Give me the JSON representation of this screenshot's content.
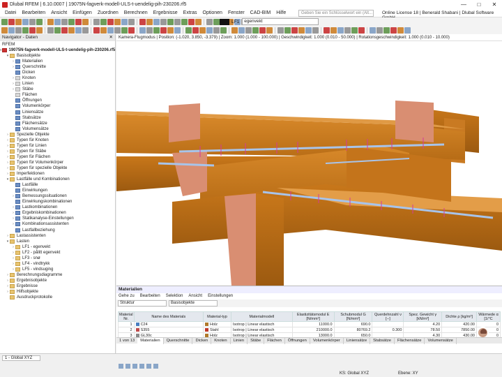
{
  "titlebar": {
    "title": "Dlubal RFEM | 6.10.0007 | 19075N-fagverk-modell-ULS-t-uendelig-pih-230206.rf5"
  },
  "menu": [
    "Datei",
    "Bearbeiten",
    "Ansicht",
    "Einfügen",
    "Zuordnen",
    "Berechnen",
    "Ergebnisse",
    "Extras",
    "Optionen",
    "Fenster",
    "CAD-BIM",
    "Hilfe"
  ],
  "search_placeholder": "Geben Sie ein Schlüsselwort ein (Alt...",
  "license": "Online License 18 | Benerald Shabani | Dlubal Software GmbH",
  "loadcase": {
    "code": "LF1",
    "name": "egenvekt"
  },
  "navigator": {
    "title": "Navigator - Daten",
    "root": "RFEM",
    "file": "19075N-fagverk-modell-ULS-t-uendelig-pih-230206.rf5",
    "items": [
      {
        "t": "Basisobjekte",
        "lvl": 1,
        "ex": "v",
        "ic": "f"
      },
      {
        "t": "Materialien",
        "lvl": 2,
        "ex": ">",
        "ic": "b"
      },
      {
        "t": "Querschnitte",
        "lvl": 2,
        "ex": ">",
        "ic": "b"
      },
      {
        "t": "Dicken",
        "lvl": 2,
        "ex": "",
        "ic": "b"
      },
      {
        "t": "Knoten",
        "lvl": 2,
        "ex": ">",
        "ic": "p"
      },
      {
        "t": "Linien",
        "lvl": 2,
        "ex": ">",
        "ic": "p"
      },
      {
        "t": "Stäbe",
        "lvl": 2,
        "ex": ">",
        "ic": "p"
      },
      {
        "t": "Flächen",
        "lvl": 2,
        "ex": "",
        "ic": "p"
      },
      {
        "t": "Öffnungen",
        "lvl": 2,
        "ex": "",
        "ic": "b"
      },
      {
        "t": "Volumenkörper",
        "lvl": 2,
        "ex": "",
        "ic": "b"
      },
      {
        "t": "Liniensätze",
        "lvl": 2,
        "ex": "",
        "ic": "b"
      },
      {
        "t": "Stabsätze",
        "lvl": 2,
        "ex": "",
        "ic": "b"
      },
      {
        "t": "Flächensätze",
        "lvl": 2,
        "ex": "",
        "ic": "b"
      },
      {
        "t": "Volumensätze",
        "lvl": 2,
        "ex": "",
        "ic": "b"
      },
      {
        "t": "Spezielle Objekte",
        "lvl": 1,
        "ex": ">",
        "ic": "f"
      },
      {
        "t": "Typen für Knoten",
        "lvl": 1,
        "ex": ">",
        "ic": "f"
      },
      {
        "t": "Typen für Linien",
        "lvl": 1,
        "ex": ">",
        "ic": "f"
      },
      {
        "t": "Typen für Stäbe",
        "lvl": 1,
        "ex": ">",
        "ic": "f"
      },
      {
        "t": "Typen für Flächen",
        "lvl": 1,
        "ex": ">",
        "ic": "f"
      },
      {
        "t": "Typen für Volumenkörper",
        "lvl": 1,
        "ex": ">",
        "ic": "f"
      },
      {
        "t": "Typen für spezielle Objekte",
        "lvl": 1,
        "ex": ">",
        "ic": "f"
      },
      {
        "t": "Imperfektionen",
        "lvl": 1,
        "ex": ">",
        "ic": "f"
      },
      {
        "t": "Lastfälle und Kombinationen",
        "lvl": 1,
        "ex": "v",
        "ic": "f"
      },
      {
        "t": "Lastfälle",
        "lvl": 2,
        "ex": "",
        "ic": "b"
      },
      {
        "t": "Einwirkungen",
        "lvl": 2,
        "ex": "",
        "ic": "b"
      },
      {
        "t": "Bemessungssituationen",
        "lvl": 2,
        "ex": ">",
        "ic": "b"
      },
      {
        "t": "Einwirkungskombinationen",
        "lvl": 2,
        "ex": "",
        "ic": "b"
      },
      {
        "t": "Lastkombinationen",
        "lvl": 2,
        "ex": ">",
        "ic": "b"
      },
      {
        "t": "Ergebniskombinationen",
        "lvl": 2,
        "ex": ">",
        "ic": "b"
      },
      {
        "t": "Statikanalyse-Einstellungen",
        "lvl": 2,
        "ex": ">",
        "ic": "b"
      },
      {
        "t": "Kombinationsassistenten",
        "lvl": 2,
        "ex": ">",
        "ic": "b"
      },
      {
        "t": "Lastfallbeziehung",
        "lvl": 2,
        "ex": "",
        "ic": "b"
      },
      {
        "t": "Lastassistenten",
        "lvl": 1,
        "ex": ">",
        "ic": "f"
      },
      {
        "t": "Lasten",
        "lvl": 1,
        "ex": "v",
        "ic": "f"
      },
      {
        "t": "LF1 - egenvekt",
        "lvl": 2,
        "ex": ">",
        "ic": "f"
      },
      {
        "t": "LF2 - pålitt egenvekt",
        "lvl": 2,
        "ex": ">",
        "ic": "f"
      },
      {
        "t": "LF3 - snø",
        "lvl": 2,
        "ex": ">",
        "ic": "f"
      },
      {
        "t": "LF4 - vindtrykk",
        "lvl": 2,
        "ex": ">",
        "ic": "f"
      },
      {
        "t": "LF5 - vindsuging",
        "lvl": 2,
        "ex": ">",
        "ic": "f"
      },
      {
        "t": "Berechnungsdiagramme",
        "lvl": 1,
        "ex": ">",
        "ic": "f"
      },
      {
        "t": "Ergebnisobjekte",
        "lvl": 1,
        "ex": ">",
        "ic": "f"
      },
      {
        "t": "Ergebnisse",
        "lvl": 1,
        "ex": ">",
        "ic": "f"
      },
      {
        "t": "Hilfsobjekte",
        "lvl": 1,
        "ex": ">",
        "ic": "f"
      },
      {
        "t": "Ausdruckprotokolle",
        "lvl": 1,
        "ex": "",
        "ic": "f"
      }
    ]
  },
  "view": {
    "info": "Kamera-Flugmodus | Position: (-1.020, 3.850, -3.379) | Zoom: 1.000 (1.000 - 100.000) | Geschwindigkeit: 1.000 (0.010 - 50.000) | Rotationsgeschwindigkeit: 1.000 (0.010 - 10.000)"
  },
  "panel": {
    "title": "Materialien",
    "menu": [
      "Gehe zu",
      "Bearbeiten",
      "Selektion",
      "Ansicht",
      "Einstellungen"
    ],
    "filter1": "Struktur",
    "filter2": "Basisobjekte",
    "columns": [
      "Material Nr.",
      "Name des Materials",
      "Material-typ",
      "Materialmodell",
      "Elastizitätsmodul E [N/mm²]",
      "Schubmodul G [N/mm²]",
      "Querdehnzahl ν [--]",
      "Spez. Gewicht γ [kN/m³]",
      "Dichte ρ [kg/m³]",
      "Wärmede α [1/°C"
    ],
    "rows": [
      {
        "nr": "1",
        "name": "C24",
        "color": "#4a7fc0",
        "typ": "Holz",
        "typcolor": "#b07a2a",
        "model": "Isotrop | Linear elastisch",
        "e": "11000.0",
        "g": "690.0",
        "nu": "",
        "gamma": "4.20",
        "rho": "420.00",
        "alpha": "0"
      },
      {
        "nr": "2",
        "name": "S355",
        "color": "#c04a4a",
        "typ": "Stahl",
        "typcolor": "#c0392b",
        "model": "Isotrop | Linear elastisch",
        "e": "210000.0",
        "g": "80769.2",
        "nu": "0.300",
        "gamma": "78.50",
        "rho": "7850.00",
        "alpha": "0"
      },
      {
        "nr": "3",
        "name": "GL30c",
        "color": "#8a8a8a",
        "typ": "Holz",
        "typcolor": "#b07a2a",
        "model": "Isotrop | Linear elastisch",
        "e": "13000.0",
        "g": "650.0",
        "nu": "",
        "gamma": "4.30",
        "rho": "430.00",
        "alpha": "0"
      }
    ],
    "page": "1 von 13",
    "tabs": [
      "Materialien",
      "Querschnitte",
      "Dicken",
      "Knoten",
      "Linien",
      "Stäbe",
      "Flächen",
      "Öffnungen",
      "Volumenkörper",
      "Liniensätze",
      "Stabsätze",
      "Flächensätze",
      "Volumensätze"
    ]
  },
  "status": {
    "view": "1 - Global XYZ",
    "cs": "KS: Global XYZ",
    "plane": "Ebene: XY"
  },
  "colors": {
    "timber": "#c47a1f",
    "timber_light": "#d99a4a",
    "beam_end": "#d9907a",
    "steel": "#9fb8e0"
  }
}
